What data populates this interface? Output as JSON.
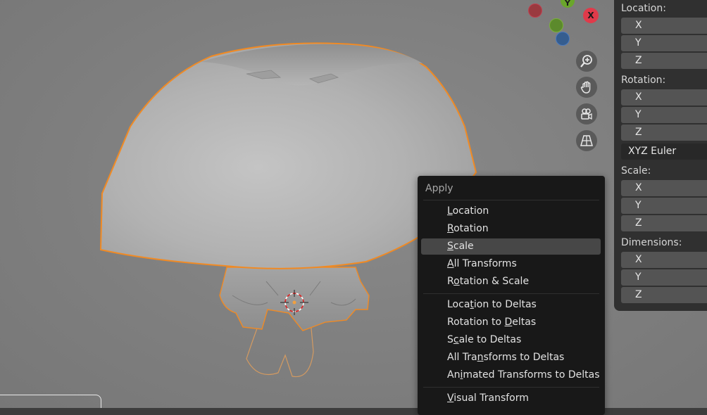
{
  "gizmo": {
    "x_label": "X",
    "y_label": "Y",
    "x_color": "#e03a4a",
    "y_color": "#6aa62b",
    "z_color": "#3d6fb0",
    "nav_icons": [
      "zoom-icon",
      "hand-pan-icon",
      "camera-icon",
      "grid-perspective-icon"
    ]
  },
  "properties": {
    "location_label": "Location:",
    "rotation_label": "Rotation:",
    "scale_label": "Scale:",
    "dimensions_label": "Dimensions:",
    "rotation_mode": "XYZ Euler",
    "axes": [
      "X",
      "Y",
      "Z"
    ]
  },
  "apply_menu": {
    "title": "Apply",
    "groups": [
      [
        {
          "pre": "",
          "key": "L",
          "post": "ocation"
        },
        {
          "pre": "",
          "key": "R",
          "post": "otation"
        },
        {
          "pre": "",
          "key": "S",
          "post": "cale"
        },
        {
          "pre": "",
          "key": "A",
          "post": "ll Transforms"
        },
        {
          "pre": "R",
          "key": "o",
          "post": "tation & Scale"
        }
      ],
      [
        {
          "pre": "Loca",
          "key": "t",
          "post": "ion to Deltas"
        },
        {
          "pre": "Rotation to ",
          "key": "D",
          "post": "eltas"
        },
        {
          "pre": "S",
          "key": "c",
          "post": "ale to Deltas"
        },
        {
          "pre": "All Tra",
          "key": "n",
          "post": "sforms to Deltas"
        },
        {
          "pre": "An",
          "key": "i",
          "post": "mated Transforms to Deltas"
        }
      ],
      [
        {
          "pre": "",
          "key": "V",
          "post": "isual Transform"
        }
      ]
    ],
    "active_item": "Scale",
    "colors": {
      "background": "#181818",
      "highlight": "#474747"
    }
  },
  "viewport": {
    "selection_outline_color": "#f08a24"
  }
}
